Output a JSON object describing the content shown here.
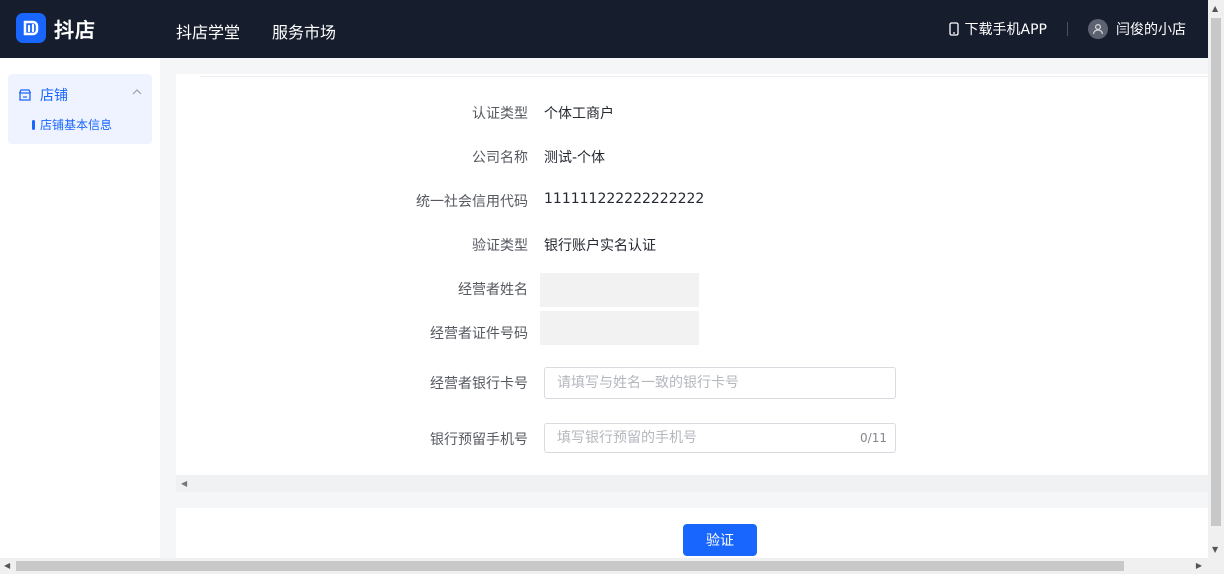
{
  "header": {
    "logo_text": "抖店",
    "nav": [
      "抖店学堂",
      "服务市场"
    ],
    "download_label": "下载手机APP",
    "user_name": "闫俊的小店"
  },
  "sidebar": {
    "group_label": "店铺",
    "items": [
      {
        "label": "店铺基本信息",
        "active": true
      }
    ]
  },
  "form": {
    "fields": [
      {
        "label": "认证类型",
        "value": "个体工商户"
      },
      {
        "label": "公司名称",
        "value": "测试-个体"
      },
      {
        "label": "统一社会信用代码",
        "value": "111111222222222222"
      },
      {
        "label": "验证类型",
        "value": "银行账户实名认证"
      },
      {
        "label": "经营者姓名",
        "value": ""
      },
      {
        "label": "经营者证件号码",
        "value": ""
      }
    ],
    "bank_card": {
      "label": "经营者银行卡号",
      "placeholder": "请填写与姓名一致的银行卡号"
    },
    "phone": {
      "label": "银行预留手机号",
      "placeholder": "填写银行预留的手机号",
      "counter": "0/11"
    }
  },
  "actions": {
    "verify_label": "验证"
  },
  "colors": {
    "brand": "#1966ff",
    "header_bg": "#161e2e"
  }
}
